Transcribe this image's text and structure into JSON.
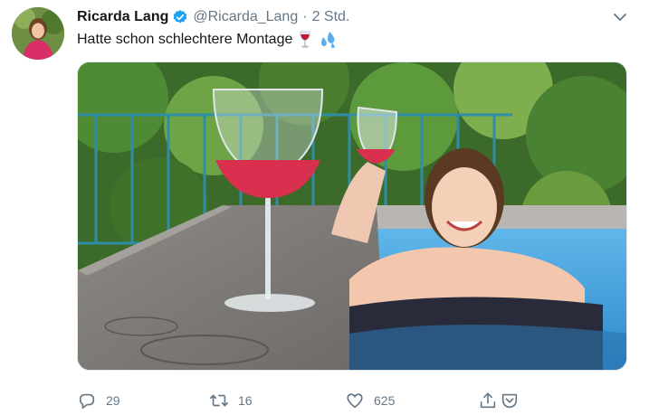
{
  "tweet": {
    "display_name": "Ricarda Lang",
    "verified_icon": "verified-badge-icon",
    "handle": "@Ricarda_Lang",
    "separator": "·",
    "time": "2 Std.",
    "text": "Hatte schon schlechtere Montage",
    "emojis": [
      "wine-glass-emoji",
      "sweat-droplets-emoji"
    ]
  },
  "actions": {
    "reply_count": "29",
    "retweet_count": "16",
    "like_count": "625"
  },
  "colors": {
    "verified": "#1da1f2",
    "secondary_text": "#657786",
    "primary_text": "#14171a"
  }
}
